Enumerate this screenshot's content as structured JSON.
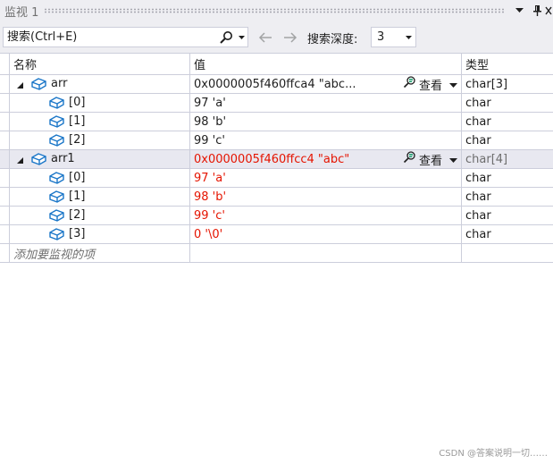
{
  "window": {
    "title": "监视 1",
    "pin_icon": "pin-icon",
    "close_icon": "close-icon"
  },
  "toolbar": {
    "search_placeholder": "搜索(Ctrl+E)",
    "search_icon": "search-icon",
    "back_icon": "arrow-left-icon",
    "forward_icon": "arrow-right-icon",
    "depth_label": "搜索深度:",
    "depth_value": "3"
  },
  "columns": {
    "name": "名称",
    "value": "值",
    "type": "类型"
  },
  "rows": [
    {
      "name": "arr",
      "value": "0x0000005f460ffca4 \"abc...",
      "type": "char[3]",
      "view_label": "查看",
      "expanded": true,
      "level": 0,
      "changed": false
    },
    {
      "name": "[0]",
      "value": "97 'a'",
      "type": "char",
      "level": 1,
      "changed": false
    },
    {
      "name": "[1]",
      "value": "98 'b'",
      "type": "char",
      "level": 1,
      "changed": false
    },
    {
      "name": "[2]",
      "value": "99 'c'",
      "type": "char",
      "level": 1,
      "changed": false
    },
    {
      "name": "arr1",
      "value": "0x0000005f460ffcc4 \"abc\"",
      "type": "char[4]",
      "view_label": "查看",
      "expanded": true,
      "level": 0,
      "changed": true,
      "selected": true
    },
    {
      "name": "[0]",
      "value": "97 'a'",
      "type": "char",
      "level": 1,
      "changed": true
    },
    {
      "name": "[1]",
      "value": "98 'b'",
      "type": "char",
      "level": 1,
      "changed": true
    },
    {
      "name": "[2]",
      "value": "99 'c'",
      "type": "char",
      "level": 1,
      "changed": true
    },
    {
      "name": "[3]",
      "value": "0 '\\0'",
      "type": "char",
      "level": 1,
      "changed": true
    }
  ],
  "add_watch_placeholder": "添加要监视的项",
  "watermark": "CSDN @答案说明一切……",
  "colors": {
    "changed_value": "#e51400",
    "object_icon": "#1a76c8",
    "selected_row": "#e8e8f0",
    "grid_line": "#cccedb"
  }
}
